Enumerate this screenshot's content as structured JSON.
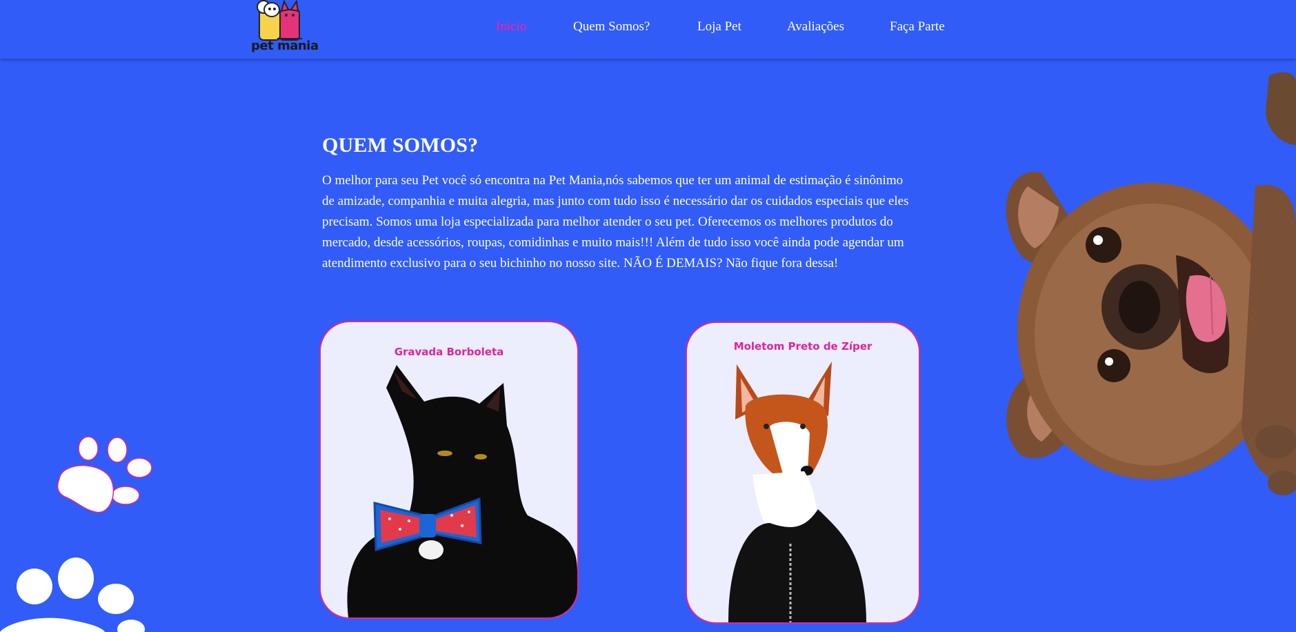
{
  "header": {
    "logo_text": "pet mania",
    "nav": [
      {
        "label": "Início",
        "active": true
      },
      {
        "label": "Quem Somos?",
        "active": false
      },
      {
        "label": "Loja Pet",
        "active": false
      },
      {
        "label": "Avaliações",
        "active": false
      },
      {
        "label": "Faça Parte",
        "active": false
      }
    ]
  },
  "about": {
    "title": "QUEM SOMOS?",
    "text": "O melhor para seu Pet você só encontra na Pet Mania,nós sabemos que ter um animal de estimação é sinônimo de amizade, companhia e muita alegria, mas junto com tudo isso é necessário dar os cuidados especiais que eles precisam. Somos uma loja especializada para melhor atender o seu pet. Oferecemos os melhores produtos do mercado, desde acessórios, roupas, comidinhas e muito mais!!! Além de tudo isso você ainda pode agendar um atendimento exclusivo para o seu bichinho no nosso site. NÃO É DEMAIS? Não fique fora dessa!"
  },
  "products": [
    {
      "title": "Gravada Borboleta",
      "image": "black-cat-with-bowtie"
    },
    {
      "title": "Moletom Preto de Zíper",
      "image": "dog-in-black-hoodie"
    }
  ],
  "colors": {
    "background": "#315cf8",
    "accent": "#e0249a",
    "active_nav": "#ff1fa4",
    "card_bg": "#eceefd"
  },
  "icons": [
    "paw-print-icon",
    "french-bulldog-image",
    "pet-mania-logo"
  ]
}
